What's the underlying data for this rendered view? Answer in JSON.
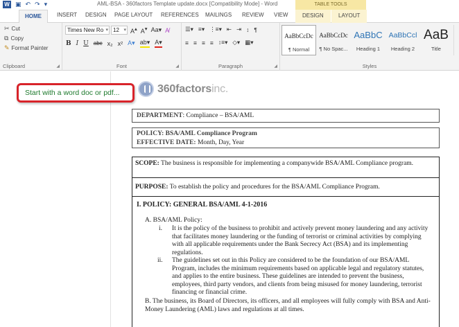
{
  "titlebar": {
    "title": "AML-BSA - 360factors Template update.docx [Compatibility Mode] - Word",
    "table_tools": "TABLE TOOLS"
  },
  "tabs": [
    "HOME",
    "INSERT",
    "DESIGN",
    "PAGE LAYOUT",
    "REFERENCES",
    "MAILINGS",
    "REVIEW",
    "VIEW",
    "DESIGN",
    "LAYOUT"
  ],
  "clipboard": {
    "cut": "Cut",
    "copy": "Copy",
    "format_painter": "Format Painter",
    "label": "Clipboard"
  },
  "font": {
    "name": "Times New Ro",
    "size": "12",
    "label": "Font"
  },
  "paragraph": {
    "label": "Paragraph"
  },
  "styles": {
    "label": "Styles",
    "items": [
      {
        "sample": "AaBbCcDc",
        "name": "¶ Normal"
      },
      {
        "sample": "AaBbCcDc",
        "name": "¶ No Spac..."
      },
      {
        "sample": "AaBbC",
        "name": "Heading 1"
      },
      {
        "sample": "AaBbCcl",
        "name": "Heading 2"
      },
      {
        "sample": "AaB",
        "name": "Title"
      }
    ]
  },
  "callout": "Start with a word doc or pdf...",
  "logo": {
    "brand": "360factors",
    "suffix": "inc."
  },
  "document": {
    "department_label": "DEPARTMENT",
    "department_value": ": Compliance – BSA/AML",
    "policy_line": "POLICY:  BSA/AML Compliance Program",
    "effective_label": "EFFECTIVE DATE:",
    "effective_value": " Month, Day, Year",
    "scope_label": "SCOPE:",
    "scope_text": "  The business is responsible for implementing a companywide BSA/AML Compliance program.",
    "purpose_label": "PURPOSE:",
    "purpose_text": "  To establish the policy and procedures for the BSA/AML Compliance Program.",
    "section_title": "I.    POLICY: GENERAL  BSA/AML   4-1-2016",
    "item_a": "A.  BSA/AML Policy:",
    "item_i_num": "i.",
    "item_i_text": "It is the policy of the business to prohibit and actively prevent money laundering and any activity that facilitates money laundering or the funding of terrorist or criminal activities by complying with all applicable requirements under the Bank Secrecy Act (BSA) and its implementing regulations.",
    "item_ii_num": "ii.",
    "item_ii_text": "The guidelines set out in this Policy are considered to be the foundation of our BSA/AML Program, includes the minimum requirements based on applicable legal and regulatory statutes, and applies to the entire business. These guidelines are intended to prevent the business, employees, third party vendors, and clients from being misused for money laundering, terrorist financing or financial crime.",
    "item_b": "B.  The business, its Board of Directors, its officers, and all employees will fully comply with BSA and Anti-Money Laundering (AML) laws and regulations at all times."
  }
}
